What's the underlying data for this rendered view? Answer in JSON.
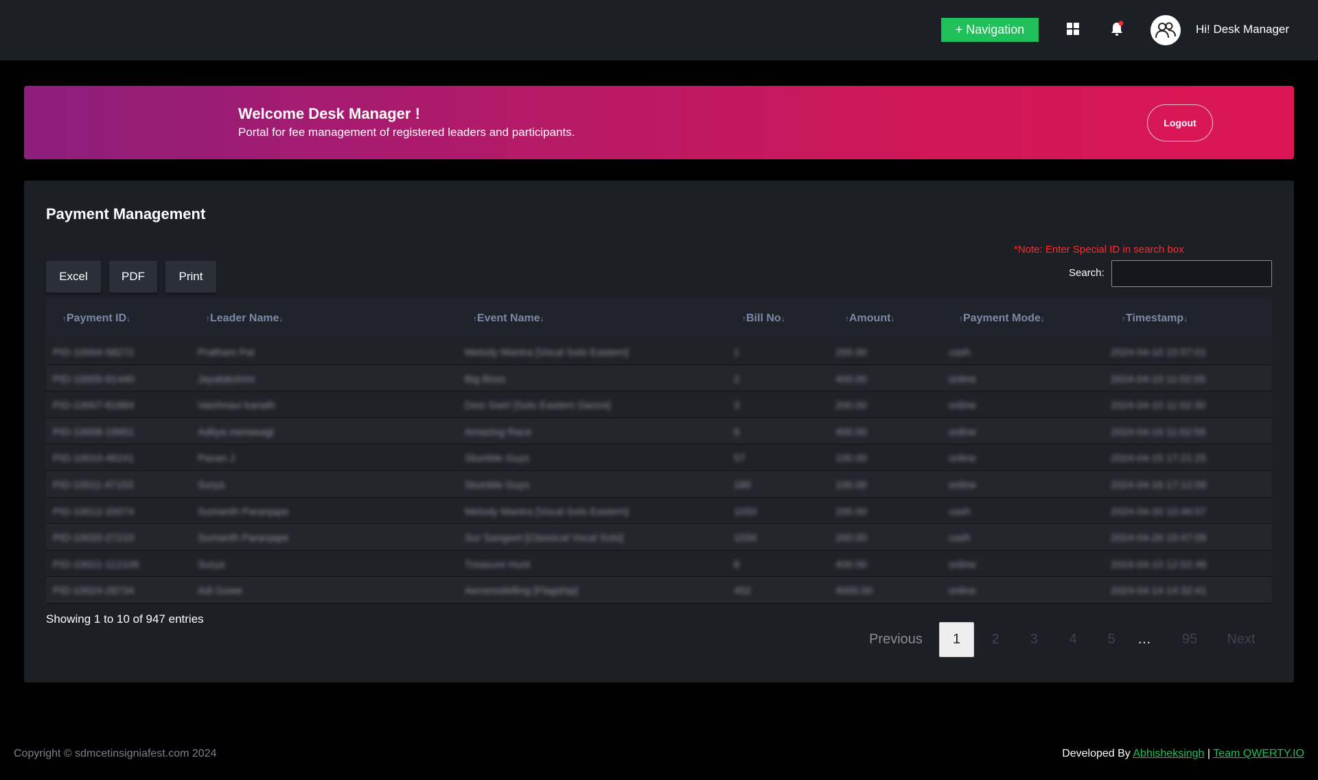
{
  "header": {
    "nav_button": "+ Navigation",
    "grid_icon": "apps-grid-icon",
    "bell_icon": "bell-icon",
    "notification_color": "#ff2a2a",
    "avatar_icon": "users-icon",
    "greeting": "Hi! Desk Manager"
  },
  "banner": {
    "title": "Welcome Desk Manager !",
    "subtitle": "Portal for fee management of registered leaders and participants.",
    "logout_label": "Logout"
  },
  "main": {
    "title": "Payment Management",
    "export_buttons": [
      "Excel",
      "PDF",
      "Print"
    ],
    "note": "*Note: Enter Special ID in search box",
    "search_label": "Search:",
    "search_value": ""
  },
  "table": {
    "columns": [
      "Payment ID",
      "Leader Name",
      "Event Name",
      "Bill No",
      "Amount",
      "Payment Mode",
      "Timestamp"
    ],
    "rows": [
      [
        "PID-10004-58272",
        "Pratham Pai",
        "Melody Mantra [Vocal Solo Eastern]",
        "1",
        "200.00",
        "cash",
        "2024-04-10 15:57:01"
      ],
      [
        "PID-10005-91440",
        "Jayalakshmi",
        "Big Boss",
        "2",
        "400.00",
        "online",
        "2024-04-10 11:02:05"
      ],
      [
        "PID-10007-81884",
        "Vaishnavi kanath",
        "Desi Swirl [Solo Eastern Dance]",
        "3",
        "200.00",
        "online",
        "2024-04-10 11:02:30"
      ],
      [
        "PID-10008-19951",
        "Aditya menasagi",
        "Amazing Race",
        "6",
        "400.00",
        "online",
        "2024-04-10 11:02:59"
      ],
      [
        "PID-10010-46241",
        "Pavan J",
        "Stumble Guys",
        "57",
        "100.00",
        "online",
        "2024-04-15 17:21:25"
      ],
      [
        "PID-10011-47153",
        "Surya",
        "Stumble Guys",
        "180",
        "100.00",
        "online",
        "2024-04-16 17:12:09"
      ],
      [
        "PID-10012-20074",
        "Sumanth Paranjape",
        "Melody Mantra [Vocal Solo Eastern]",
        "1033",
        "200.00",
        "cash",
        "2024-04-20 10:46:57"
      ],
      [
        "PID-10020-27210",
        "Sumanth Paranjape",
        "Sur Sangeet [Classical Vocal Solo]",
        "1034",
        "200.00",
        "cash",
        "2024-04-20 10:47:09"
      ],
      [
        "PID-10021-112106",
        "Surya",
        "Treasure Hunt",
        "8",
        "400.00",
        "online",
        "2024-04-10 12:02:48"
      ],
      [
        "PID-10024-28734",
        "Adi Gowe",
        "Aeromodelling [Flagship]",
        "452",
        "4000.00",
        "online",
        "2024-04-14 14:32:41"
      ]
    ]
  },
  "pagination": {
    "info": "Showing 1 to 10 of 947 entries",
    "previous": "Previous",
    "pages": [
      "1",
      "2",
      "3",
      "4",
      "5"
    ],
    "ellipsis": "…",
    "last_page": "95",
    "next": "Next",
    "current_page": 1
  },
  "footer": {
    "copyright": "Copyright © sdmcetinsigniafest.com 2024",
    "developed_by": "Developed By",
    "author": "Abhisheksingh",
    "separator": "|",
    "team": "Team QWERTY.IO"
  }
}
